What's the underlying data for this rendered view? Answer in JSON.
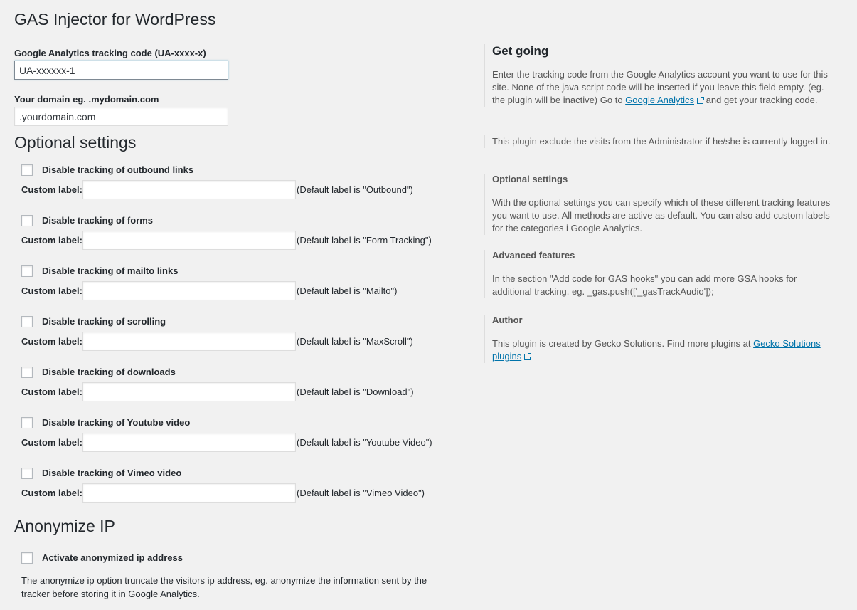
{
  "title": "GAS Injector for WordPress",
  "tracking": {
    "label": "Google Analytics tracking code (UA-xxxx-x)",
    "value": "UA-xxxxxx-1"
  },
  "domain": {
    "label": "Your domain eg. .mydomain.com",
    "value": ".yourdomain.com"
  },
  "optional": {
    "heading": "Optional settings",
    "custom_label": "Custom label:",
    "items": [
      {
        "label": "Disable tracking of outbound links",
        "note": "(Default label is \"Outbound\")"
      },
      {
        "label": "Disable tracking of forms",
        "note": "(Default label is \"Form Tracking\")"
      },
      {
        "label": "Disable tracking of mailto links",
        "note": "(Default label is \"Mailto\")"
      },
      {
        "label": "Disable tracking of scrolling",
        "note": "(Default label is \"MaxScroll\")"
      },
      {
        "label": "Disable tracking of downloads",
        "note": "(Default label is \"Download\")"
      },
      {
        "label": "Disable tracking of Youtube video",
        "note": "(Default label is \"Youtube Video\")"
      },
      {
        "label": "Disable tracking of Vimeo video",
        "note": "(Default label is \"Vimeo Video\")"
      }
    ]
  },
  "anonymize": {
    "heading": "Anonymize IP",
    "checkbox_label": "Activate anonymized ip address",
    "description": "The anonymize ip option truncate the visitors ip address, eg. anonymize the information sent by the tracker before storing it in Google Analytics."
  },
  "sidebar": {
    "get_going": {
      "title": "Get going",
      "text_before": "Enter the tracking code from the Google Analytics account you want to use for this site. None of the java script code will be inserted if you leave this field empty. (eg. the plugin will be inactive) Go to",
      "link": "Google Analytics",
      "text_after": "and get your tracking code."
    },
    "admin_note": "This plugin exclude the visits from the Administrator if he/she is currently logged in.",
    "optional": {
      "title": "Optional settings",
      "text": "With the optional settings you can specify which of these different tracking features you want to use. All methods are active as default. You can also add custom labels for the categories i Google Analytics."
    },
    "advanced": {
      "title": "Advanced features",
      "text": "In the section \"Add code for GAS hooks\" you can add more GSA hooks for additional tracking. eg. _gas.push(['_gasTrackAudio']);"
    },
    "author": {
      "title": "Author",
      "text": "This plugin is created by Gecko Solutions. Find more plugins at",
      "link": "Gecko Solutions plugins"
    }
  }
}
